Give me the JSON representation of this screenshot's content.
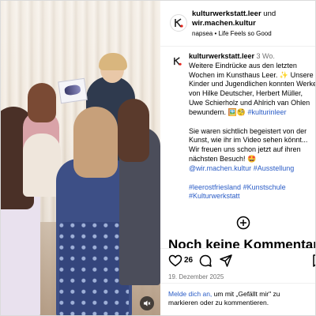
{
  "header": {
    "account": "kulturwerkstatt.leer",
    "and": "und",
    "collaborator": "wir.machen.kultur",
    "audio_artist": "napsea",
    "bullet": "•",
    "audio_title": "Life Feels so Good"
  },
  "caption": {
    "author": "kulturwerkstatt.leer",
    "age": "3 Wo.",
    "p1": "Weitere Eindrücke aus den letzten Wochen im Kunsthaus Leer. ✨ Unsere Kinder und Jugendlichen konnten Werke von Hilke Deutscher, Herbert Müller, Uwe Schierholz und Ahlrich van Ohlen bewundern. 🖼️🧐",
    "p1_tag": "#kulturinleer",
    "p2": "Sie waren sichtlich begeistert von der Kunst, wie ihr im Video sehen könnt... Wir freuen uns schon jetzt auf ihren nächsten Besuch! 🤩",
    "p2_mention": "@wir.machen.kultur",
    "p2_tag": "#Ausstellung",
    "tag1": "#leerostfriesland",
    "tag2": "#Kunstschule",
    "tag3": "#Kulturwerkstatt"
  },
  "comments": {
    "empty_title": "Noch keine Kommentare"
  },
  "actions": {
    "likes": "26",
    "date": "19. Dezember 2025"
  },
  "login": {
    "link": "Melde dich an,",
    "text": " um mit „Gefällt mir\" zu markieren oder zu kommentieren."
  },
  "icons": {
    "like": "heart-icon",
    "comment": "comment-icon",
    "share": "share-icon",
    "save": "bookmark-icon",
    "add": "add-comment-icon",
    "mute": "speaker-muted-icon"
  },
  "colors": {
    "link": "#2a5cc6",
    "muted": "#737373",
    "logo_red": "#e2231a"
  }
}
